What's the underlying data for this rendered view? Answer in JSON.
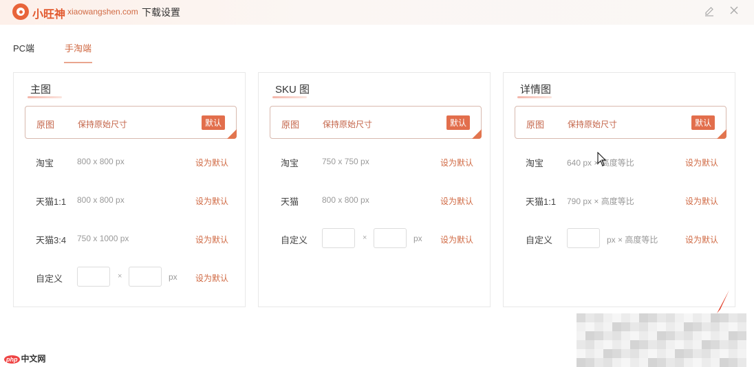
{
  "titlebar": {
    "brand": "小旺神",
    "domain": "xiaowangshen.com",
    "title": "下载设置",
    "edit_icon": "pencil-icon",
    "close_icon": "close-icon"
  },
  "tabs": [
    {
      "label": "PC端",
      "active": false
    },
    {
      "label": "手淘端",
      "active": true
    }
  ],
  "panels": [
    {
      "title": "主图",
      "original": {
        "label": "原图",
        "desc": "保持原始尺寸",
        "badge": "默认"
      },
      "rows": [
        {
          "name": "淘宝",
          "size": "800 x 800 px",
          "action": "设为默认"
        },
        {
          "name": "天猫1:1",
          "size": "800 x 800 px",
          "action": "设为默认"
        },
        {
          "name": "天猫3:4",
          "size": "750 x 1000 px",
          "action": "设为默认"
        },
        {
          "name": "自定义",
          "times": "×",
          "unit": "px",
          "action": "设为默认"
        }
      ]
    },
    {
      "title": "SKU 图",
      "original": {
        "label": "原图",
        "desc": "保持原始尺寸",
        "badge": "默认"
      },
      "rows": [
        {
          "name": "淘宝",
          "size": "750 x 750 px",
          "action": "设为默认"
        },
        {
          "name": "天猫",
          "size": "800 x 800 px",
          "action": "设为默认"
        },
        {
          "name": "自定义",
          "times": "×",
          "unit": "px",
          "action": "设为默认"
        }
      ]
    },
    {
      "title": "详情图",
      "original": {
        "label": "原图",
        "desc": "保持原始尺寸",
        "badge": "默认"
      },
      "rows": [
        {
          "name": "淘宝",
          "size": "640 px × 高度等比",
          "action": "设为默认"
        },
        {
          "name": "天猫1:1",
          "size": "790 px × 高度等比",
          "action": "设为默认"
        },
        {
          "name": "自定义",
          "unit": "px × 高度等比",
          "action": "设为默认"
        }
      ]
    }
  ],
  "watermark": {
    "badge": "php",
    "text": "中文网"
  },
  "colors": {
    "accent": "#e26e4c",
    "link": "#d06a44",
    "border": "#e8e8e8"
  }
}
